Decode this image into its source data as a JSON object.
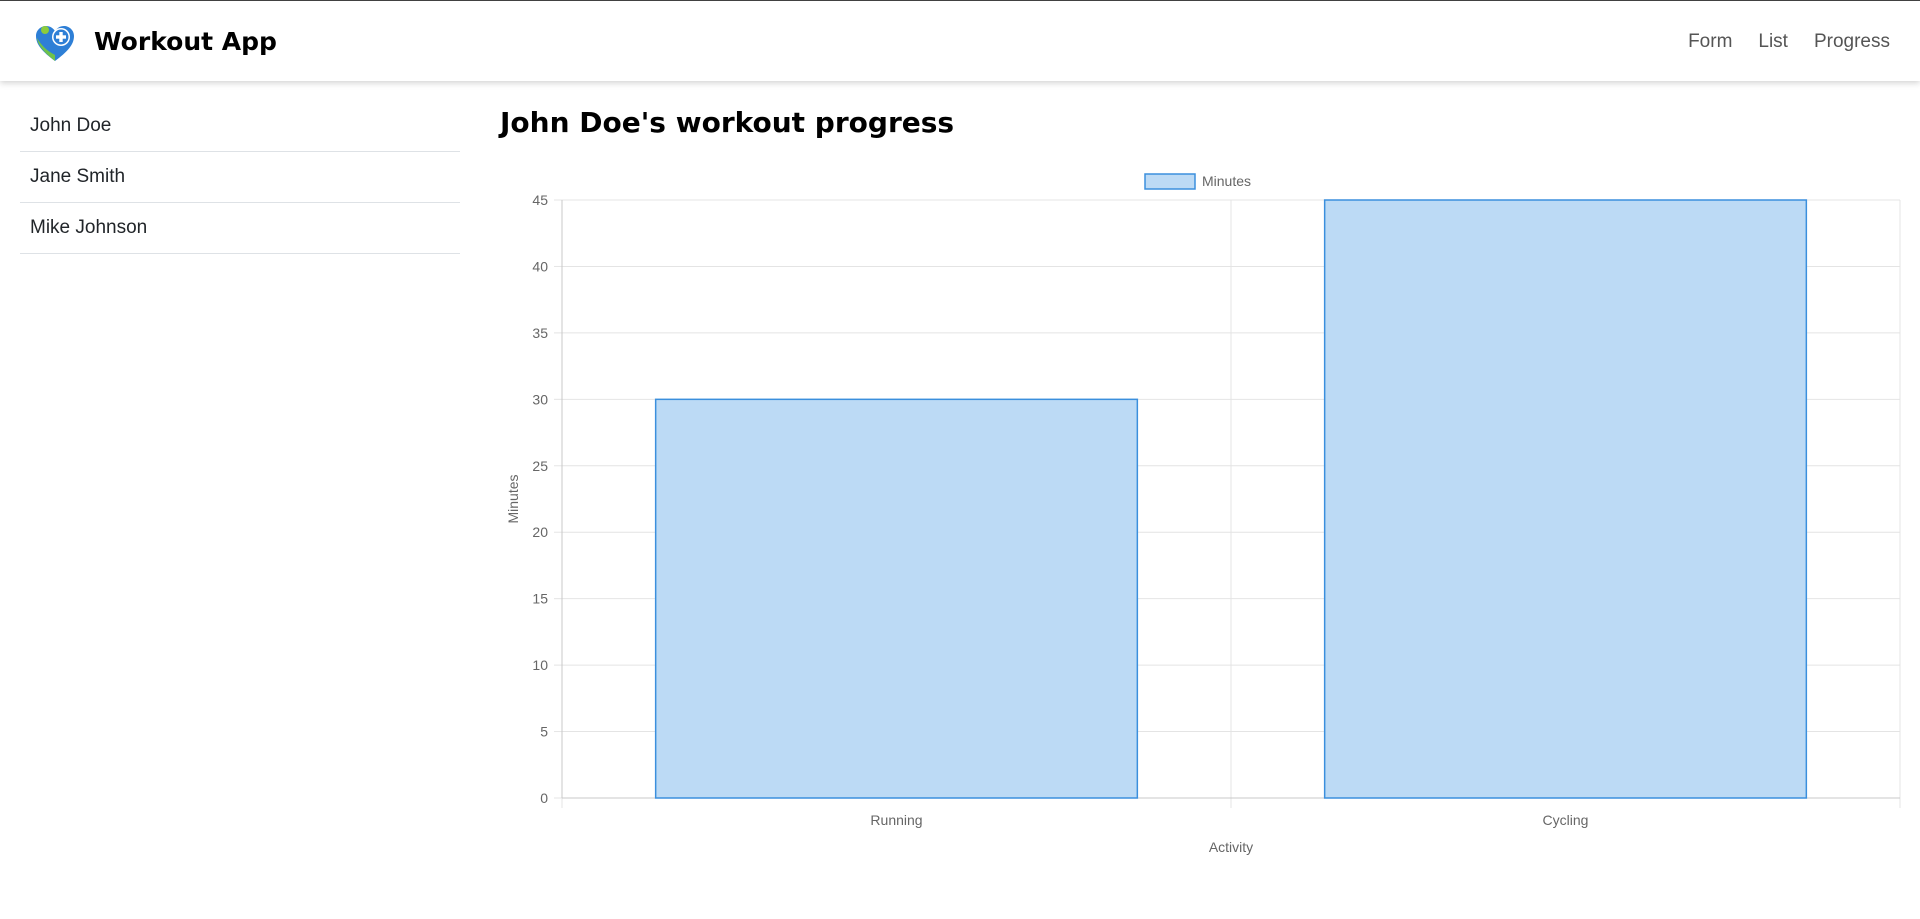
{
  "app": {
    "title": "Workout App"
  },
  "nav": {
    "items": [
      "Form",
      "List",
      "Progress"
    ]
  },
  "sidebar": {
    "users": [
      "John Doe",
      "Jane Smith",
      "Mike Johnson"
    ]
  },
  "main": {
    "title": "John Doe's workout progress"
  },
  "colors": {
    "bar_fill": "#bcdaf5",
    "bar_border": "#3b8fdd",
    "grid": "#e4e4e4"
  },
  "chart_data": {
    "type": "bar",
    "categories": [
      "Running",
      "Cycling"
    ],
    "series": [
      {
        "name": "Minutes",
        "values": [
          30,
          45
        ]
      }
    ],
    "xlabel": "Activity",
    "ylabel": "Minutes",
    "ylim": [
      0,
      45
    ],
    "yticks": [
      0,
      5,
      10,
      15,
      20,
      25,
      30,
      35,
      40,
      45
    ],
    "legend": "top-center",
    "grid": true
  }
}
